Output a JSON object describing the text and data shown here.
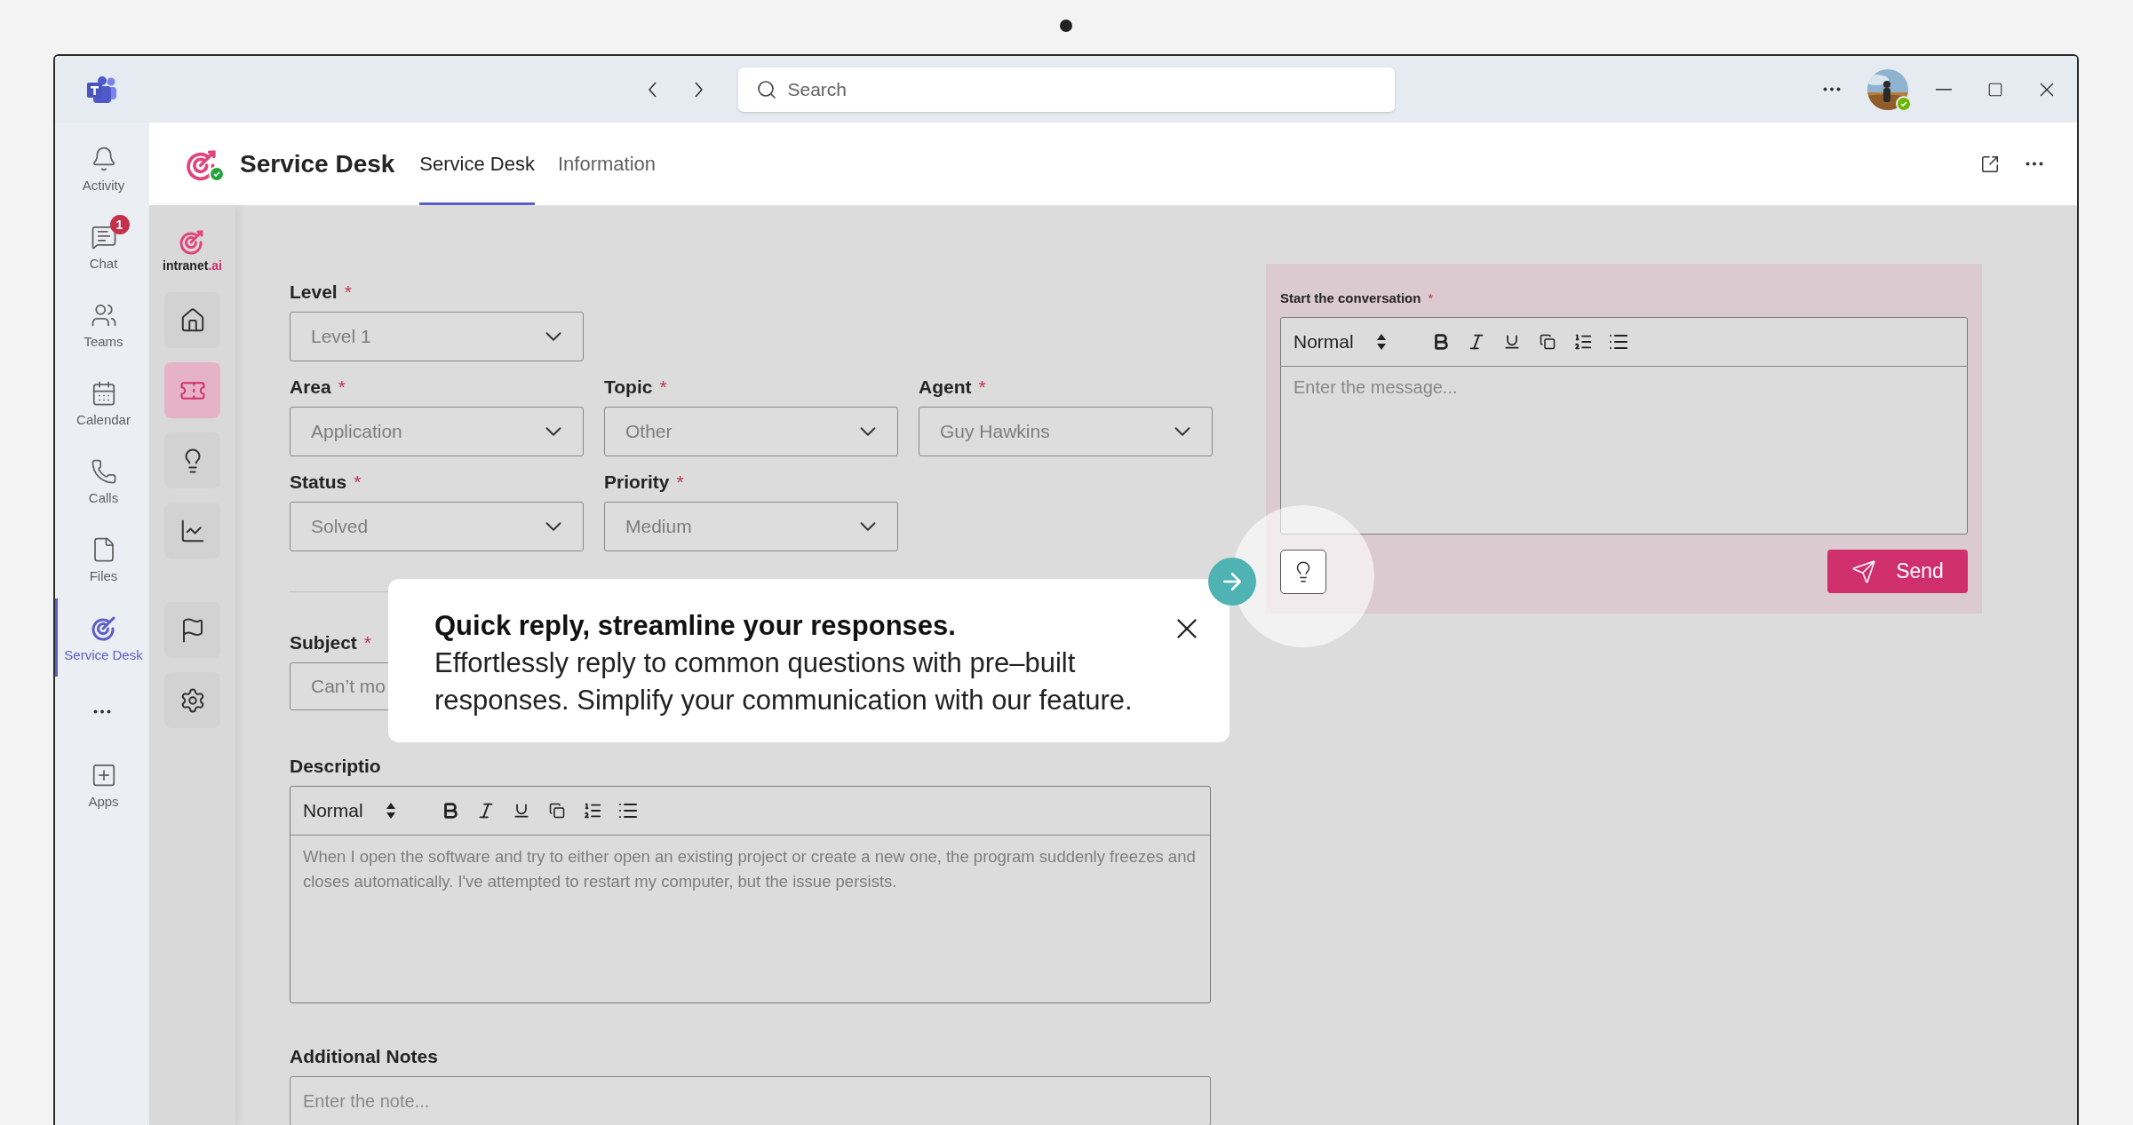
{
  "title_bar": {
    "search": {
      "placeholder": "Search"
    }
  },
  "app_rail": {
    "items": [
      {
        "label": "Activity",
        "selected": false
      },
      {
        "label": "Chat",
        "badge": "1",
        "selected": false
      },
      {
        "label": "Teams",
        "selected": false
      },
      {
        "label": "Calendar",
        "selected": false
      },
      {
        "label": "Calls",
        "selected": false
      },
      {
        "label": "Files",
        "selected": false
      },
      {
        "label": "Service Desk",
        "selected": true
      }
    ],
    "bottom_items": [
      {
        "label": "Apps",
        "selected": false
      }
    ]
  },
  "header": {
    "app_title": "Service Desk",
    "tabs": [
      {
        "label": "Service Desk",
        "selected": true
      },
      {
        "label": "Information",
        "selected": false
      }
    ]
  },
  "app_sidebar": {
    "brand": {
      "name": "intranet",
      "suffix": ".ai"
    },
    "groups": [
      {
        "items": [
          {
            "selected": false
          },
          {
            "selected": true
          },
          {
            "selected": false
          },
          {
            "selected": false
          }
        ]
      },
      {
        "items": [
          {
            "selected": false
          },
          {
            "selected": false
          }
        ]
      }
    ]
  },
  "form": {
    "rows": [
      {
        "fields": [
          {
            "label": "Level",
            "required_mark": "*",
            "value": "Level 1"
          }
        ]
      },
      {
        "fields": [
          {
            "label": "Area",
            "required_mark": "*",
            "value": "Application"
          },
          {
            "label": "Topic",
            "required_mark": "*",
            "value": "Other"
          },
          {
            "label": "Agent",
            "required_mark": "*",
            "value": "Guy Hawkins"
          }
        ]
      },
      {
        "fields": [
          {
            "label": "Status",
            "required_mark": "*",
            "value": "Solved"
          },
          {
            "label": "Priority",
            "required_mark": "*",
            "value": "Medium"
          }
        ]
      }
    ],
    "subject": {
      "label": "Subject",
      "required_mark": "*",
      "value": "Can’t mo"
    },
    "description": {
      "label": "Descriptio",
      "toolbar": {
        "style": "Normal"
      },
      "value": "When I open the software and try to either open an existing project or create a new one, the program suddenly freezes and closes automatically. I've attempted to restart my computer, but the issue persists."
    },
    "notes": {
      "label": "Additional Notes",
      "placeholder": "Enter the note..."
    }
  },
  "conversation": {
    "label": "Start the conversation",
    "required_mark": "*",
    "toolbar": {
      "style": "Normal"
    },
    "placeholder": "Enter the message...",
    "send_label": "Send"
  },
  "tip": {
    "title": "Quick reply, streamline your responses.",
    "body": "Effortlessly reply to common questions with pre–built responses. Simplify your communication with our feature."
  }
}
